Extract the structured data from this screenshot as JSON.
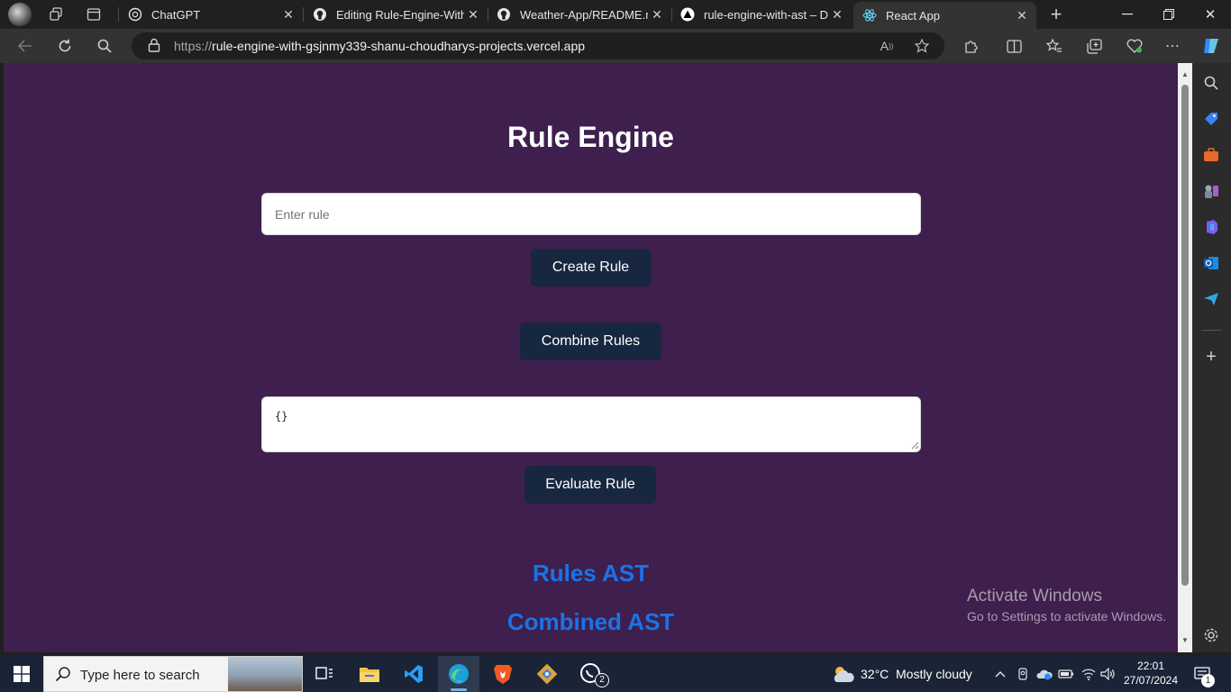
{
  "browser": {
    "tabs": [
      {
        "label": "ChatGPT",
        "icon": "chatgpt-icon"
      },
      {
        "label": "Editing Rule-Engine-With-",
        "icon": "github-icon"
      },
      {
        "label": "Weather-App/README.md",
        "icon": "github-icon"
      },
      {
        "label": "rule-engine-with-ast – Dep",
        "icon": "vercel-icon"
      },
      {
        "label": "React App",
        "icon": "react-icon",
        "active": true
      }
    ],
    "url_prefix": "https://",
    "url_host": "rule-engine-with-gsjnmy339-shanu-choudharys-projects.vercel.app"
  },
  "app": {
    "title": "Rule Engine",
    "rule_input": {
      "placeholder": "Enter rule",
      "value": ""
    },
    "create_rule_label": "Create Rule",
    "combine_rules_label": "Combine Rules",
    "data_input": {
      "value": "{}"
    },
    "evaluate_rule_label": "Evaluate Rule",
    "rules_ast_heading": "Rules AST",
    "combined_ast_heading": "Combined AST",
    "colors": {
      "page_bg": "#3e1f4d",
      "button_bg": "#182740",
      "heading_blue": "#1a73e8"
    }
  },
  "watermark": {
    "title": "Activate Windows",
    "subtitle": "Go to Settings to activate Windows."
  },
  "taskbar": {
    "search_placeholder": "Type here to search",
    "weather": {
      "temp": "32°C",
      "condition": "Mostly cloudy"
    },
    "whatsapp_badge": "2",
    "notification_badge": "1",
    "time": "22:01",
    "date": "27/07/2024"
  }
}
